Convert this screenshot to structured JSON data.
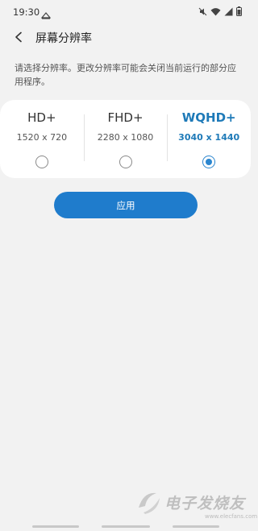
{
  "status_bar": {
    "time": "19:30",
    "left_icon": "notification-icon",
    "right_icons": [
      "mute-icon",
      "wifi-icon",
      "signal-icon",
      "battery-icon"
    ]
  },
  "header": {
    "back_icon": "back-arrow-icon",
    "title": "屏幕分辨率"
  },
  "description": "请选择分辨率。更改分辨率可能会关闭当前运行的部分应用程序。",
  "resolutions": [
    {
      "name": "HD+",
      "size": "1520 x 720",
      "selected": false
    },
    {
      "name": "FHD+",
      "size": "2280 x 1080",
      "selected": false
    },
    {
      "name": "WQHD+",
      "size": "3040 x 1440",
      "selected": true
    }
  ],
  "apply_label": "应用",
  "watermark": {
    "text": "电子发烧友",
    "url": "www.elecfans.com"
  },
  "colors": {
    "accent": "#1f7ccc",
    "selected_text": "#1e7ab8",
    "background": "#f2f2f2",
    "card": "#ffffff"
  }
}
